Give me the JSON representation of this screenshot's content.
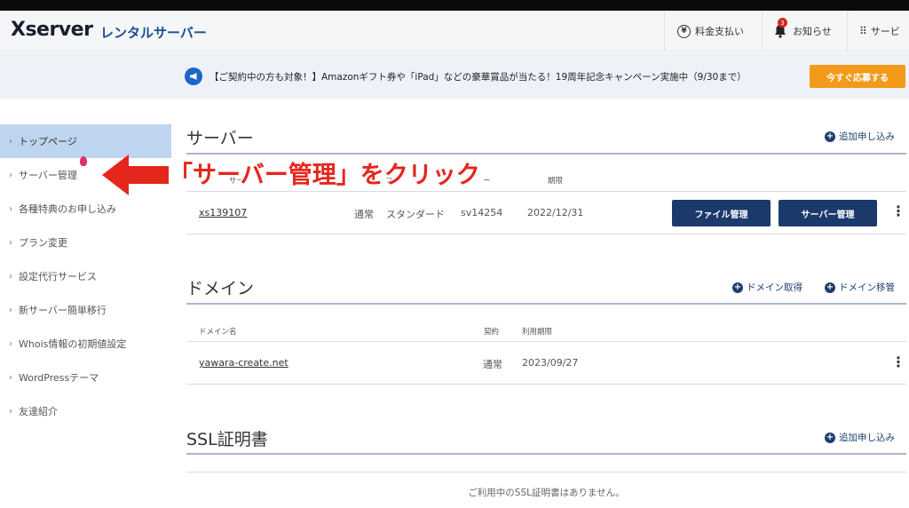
{
  "header": {
    "logo": "Xserver",
    "product": "レンタルサーバー",
    "payment_label": "料金支払い",
    "payment_icon_glyph": "¥",
    "notice_label": "お知らせ",
    "notice_count": "3",
    "services_label": "サービ"
  },
  "banner": {
    "text": "【ご契約中の方も対象！】Amazonギフト券や「iPad」などの豪華賞品が当たる！19周年記念キャンペーン実施中（9/30まで）",
    "button": "今すぐ応募する",
    "icon": "megaphone-icon"
  },
  "sidebar": {
    "items": [
      {
        "label": "トップページ"
      },
      {
        "label": "サーバー管理"
      },
      {
        "label": "各種特典のお申し込み"
      },
      {
        "label": "プラン変更"
      },
      {
        "label": "設定代行サービス"
      },
      {
        "label": "新サーバー簡単移行"
      },
      {
        "label": "Whois情報の初期値設定"
      },
      {
        "label": "WordPressテーマ"
      },
      {
        "label": "友達紹介"
      }
    ]
  },
  "server": {
    "title": "サーバー",
    "add_link": "追加申し込み",
    "headers": [
      "サー",
      "フ",
      "ー",
      "期限"
    ],
    "row": {
      "id": "xs139107",
      "contract": "通常",
      "plan": "スタンダード",
      "host": "sv14254",
      "expiry": "2022/12/31",
      "file_btn": "ファイル管理",
      "server_btn": "サーバー管理"
    }
  },
  "domain": {
    "title": "ドメイン",
    "acquire_link": "ドメイン取得",
    "transfer_link": "ドメイン移管",
    "headers": [
      "ドメイン名",
      "契約",
      "利用期限"
    ],
    "row": {
      "name": "yawara-create.net",
      "contract": "通常",
      "expiry": "2023/09/27"
    }
  },
  "ssl": {
    "title": "SSL証明書",
    "add_link": "追加申し込み",
    "empty": "ご利用中のSSL証明書はありません。"
  },
  "annotation": {
    "text": "「サーバー管理」をクリック",
    "color": "#e5261c"
  }
}
